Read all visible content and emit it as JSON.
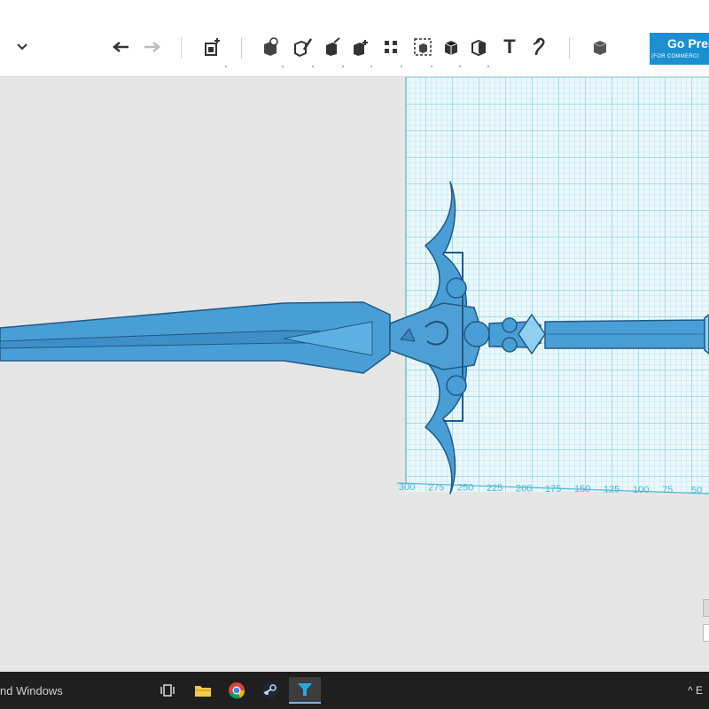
{
  "topbar": {
    "menu_chevron_icon": "chevron-down-icon"
  },
  "toolbar": {
    "undo_icon": "undo-icon",
    "redo_icon": "redo-icon",
    "text_tool_label": "T",
    "premium": {
      "label": "Go Prem",
      "sublabel": "(FOR COMMERCI",
      "color": "#1b8fd0"
    }
  },
  "viewport": {
    "grid": {
      "color": "#6fd0e6",
      "axis_labels": [
        "300",
        "275",
        "250",
        "225",
        "200",
        "175",
        "150",
        "125",
        "100",
        "75",
        "50"
      ]
    },
    "model": {
      "name": "sword",
      "color": "#4a9ed6"
    }
  },
  "taskbar": {
    "search_text": "nd Windows",
    "apps": [
      "task-view-icon",
      "file-explorer-icon",
      "chrome-icon",
      "steam-icon",
      "app-3d-icon"
    ],
    "tray_text": "^ E"
  }
}
